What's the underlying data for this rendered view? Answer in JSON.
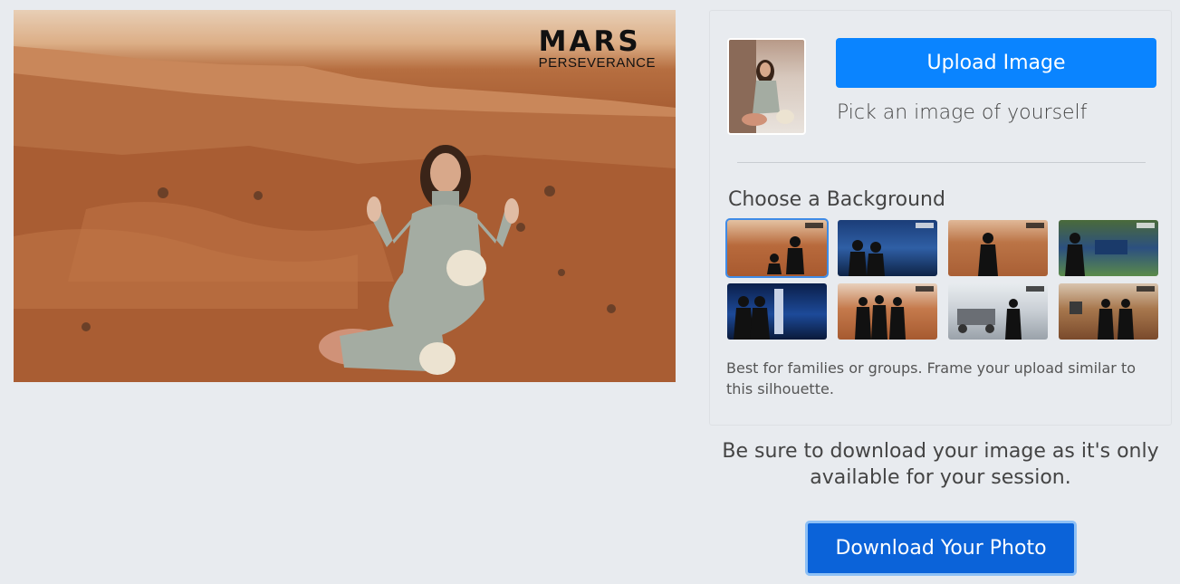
{
  "preview": {
    "logo_main": "MARS",
    "logo_sub": "PERSEVERANCE"
  },
  "upload": {
    "button_label": "Upload Image",
    "helper_text": "Pick an image of yourself"
  },
  "backgrounds": {
    "title": "Choose a Background",
    "selected_index": 0,
    "hint": "Best for families or groups. Frame your upload similar to this silhouette."
  },
  "notice": "Be sure to download your image as it's only available for your session.",
  "download": {
    "button_label": "Download Your Photo"
  },
  "colors": {
    "accent": "#0a84ff",
    "download": "#0b63d9",
    "background": "#e8ebef"
  }
}
